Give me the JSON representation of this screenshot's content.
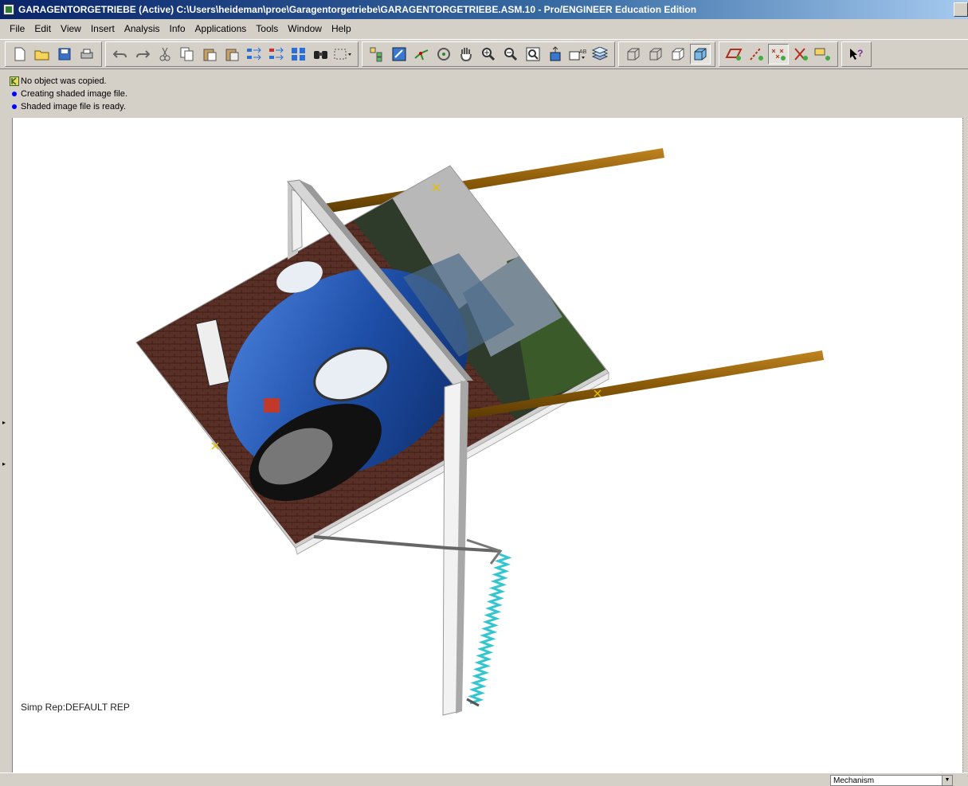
{
  "window": {
    "title": "GARAGENTORGETRIEBE (Active) C:\\Users\\heideman\\proe\\Garagentorgetriebe\\GARAGENTORGETRIEBE.ASM.10 - Pro/ENGINEER Education Edition"
  },
  "menu": {
    "items": [
      "File",
      "Edit",
      "View",
      "Insert",
      "Analysis",
      "Info",
      "Applications",
      "Tools",
      "Window",
      "Help"
    ]
  },
  "toolbar": {
    "groups": [
      [
        "new-icon",
        "open-icon",
        "save-icon",
        "print-icon"
      ],
      [
        "undo-icon",
        "redo-icon",
        "cut-icon",
        "copy-icon",
        "paste-icon",
        "paste-special-icon",
        "regenerate-icon",
        "regen-manager-icon",
        "model-tree-icon",
        "find-icon",
        "select-box-icon"
      ],
      [
        "model-tree-toggle-icon",
        "repaint-icon",
        "spin-center-icon",
        "orient-mode-icon",
        "pan-icon",
        "zoom-in-icon",
        "zoom-out-icon",
        "refit-icon",
        "reorient-icon",
        "saved-views-icon",
        "layers-icon"
      ],
      [
        "wireframe-icon",
        "hidden-line-icon",
        "no-hidden-icon",
        "shading-icon"
      ],
      [
        "datum-plane-icon",
        "datum-axis-icon",
        "datum-point-icon",
        "csys-icon",
        "annotation-icon"
      ],
      [
        "context-help-icon"
      ]
    ]
  },
  "messages": [
    {
      "icon": "copy-status-icon",
      "text": "No object was copied."
    },
    {
      "icon": "info-bullet",
      "text": "Creating shaded image file."
    },
    {
      "icon": "info-bullet",
      "text": "Shaded image file is ready."
    }
  ],
  "viewport": {
    "simp_rep": "Simp Rep:DEFAULT REP"
  },
  "status": {
    "mode": "Mechanism"
  },
  "colors": {
    "rail": "#8a5a08",
    "frame": "#e6e6e6",
    "spring": "#33c6cf",
    "car_blue": "#1e4fa8"
  }
}
